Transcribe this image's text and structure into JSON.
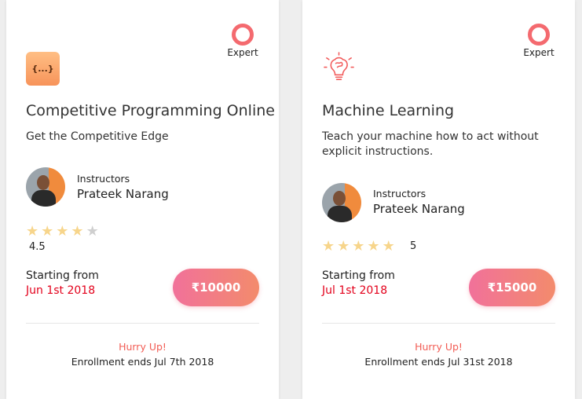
{
  "courses": [
    {
      "level": "Expert",
      "logo_icon": "code-braces-icon",
      "logo_text": "{...}",
      "title": "Competitive Programming Online",
      "subtitle": "Get the Competitive Edge",
      "instructors_label": "Instructors",
      "instructor_name": "Prateek Narang",
      "rating": "4.5",
      "stars_filled": 4,
      "stars_total": 5,
      "starting_label": "Starting from",
      "start_date": "Jun 1st 2018",
      "price": "₹10000",
      "hurry": "Hurry Up!",
      "enrollment": "Enrollment ends Jul 7th 2018"
    },
    {
      "level": "Expert",
      "logo_icon": "brain-lightbulb-icon",
      "title": "Machine Learning",
      "subtitle": "Teach your machine how to act without explicit instructions.",
      "instructors_label": "Instructors",
      "instructor_name": "Prateek Narang",
      "rating": "5",
      "stars_filled": 5,
      "stars_total": 5,
      "starting_label": "Starting from",
      "start_date": "Jul 1st 2018",
      "price": "₹15000",
      "hurry": "Hurry Up!",
      "enrollment": "Enrollment ends Jul 31st 2018"
    }
  ],
  "colors": {
    "accent_red": "#e3001b",
    "level_ring": "#f46a6f",
    "price_gradient_start": "#f1719a",
    "price_gradient_end": "#f38b6c",
    "star_filled": "#f7d58b",
    "star_empty": "#cfcfcf"
  }
}
